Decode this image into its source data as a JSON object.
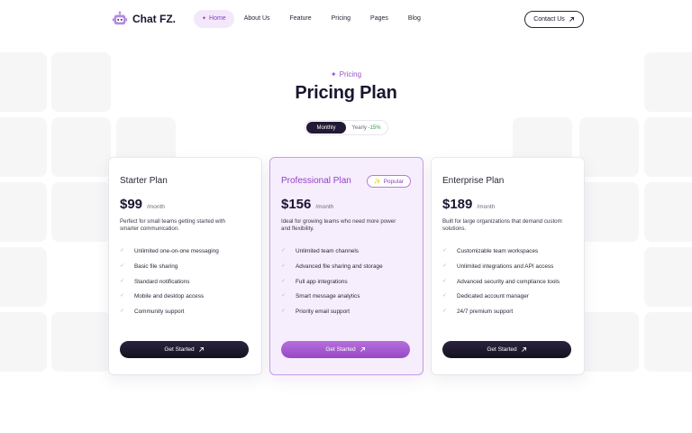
{
  "nav": {
    "brand": "Chat FZ.",
    "items": [
      "Home",
      "About Us",
      "Feature",
      "Pricing",
      "Pages",
      "Blog"
    ],
    "active": "Home",
    "contact_label": "Contact Us"
  },
  "header": {
    "eyebrow": "Pricing",
    "title": "Pricing Plan"
  },
  "billing_toggle": {
    "monthly_label": "Monthly",
    "yearly_label": "Yearly",
    "yearly_discount": "-15%",
    "selected": "Monthly"
  },
  "plans": [
    {
      "name": "Starter Plan",
      "price": "$99",
      "period": "/month",
      "description": "Perfect for small teams getting started with smarter communication.",
      "features": [
        "Unlimited one-on-one messaging",
        "Basic file sharing",
        "Standard notifications",
        "Mobile and desktop access",
        "Community support"
      ],
      "cta": "Get Started"
    },
    {
      "name": "Professional Plan",
      "badge": "Popular",
      "price": "$156",
      "period": "/month",
      "description": "Ideal for growing teams who need more power and flexibility.",
      "features": [
        "Unlimited team channels",
        "Advanced file sharing and storage",
        "Full app integrations",
        "Smart message analytics",
        "Priority email support"
      ],
      "cta": "Get Started"
    },
    {
      "name": "Enterprise Plan",
      "price": "$189",
      "period": "/month",
      "description": "Built for large organizations that demand custom solutions.",
      "features": [
        "Customizable team workspaces",
        "Unlimited integrations and API access",
        "Advanced security and compliance tools",
        "Dedicated account manager",
        "24/7 premium support"
      ],
      "cta": "Get Started"
    }
  ],
  "colors": {
    "accent": "#9a4fd0",
    "dark": "#1b1530",
    "pro_card_bg": "#f7eefd",
    "discount": "#2fa04a"
  }
}
